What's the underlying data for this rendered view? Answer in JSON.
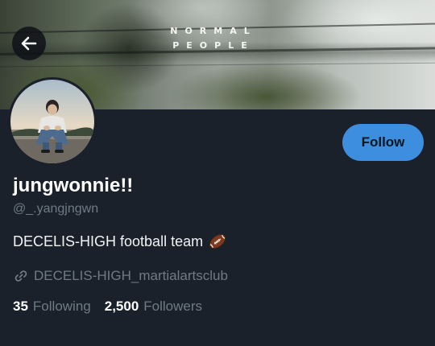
{
  "banner": {
    "title_line1": "NORMAL",
    "title_line2": "PEOPLE"
  },
  "profile": {
    "display_name": "jungwonnie!!",
    "handle": "@_.yangjngwn",
    "bio": "DECELIS-HIGH football team",
    "bio_icon": "american-football-icon",
    "link": "DECELIS-HIGH_martialartsclub"
  },
  "actions": {
    "follow_label": "Follow"
  },
  "stats": {
    "following_count": "35",
    "following_label": "Following",
    "followers_count": "2,500",
    "followers_label": "Followers"
  },
  "colors": {
    "background": "#1a212b",
    "accent": "#3e8ee0",
    "muted_text": "#6f7a85",
    "primary_text": "#ffffff"
  },
  "icons": {
    "back": "arrow-left-icon",
    "link": "link-icon"
  }
}
